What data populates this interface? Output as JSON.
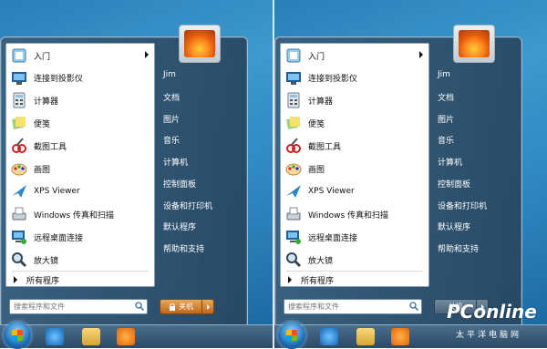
{
  "start_menu": {
    "items": [
      {
        "label": "入门",
        "icon": "getting-started-icon",
        "submenu": true
      },
      {
        "label": "连接到投影仪",
        "icon": "projector-icon"
      },
      {
        "label": "计算器",
        "icon": "calculator-icon"
      },
      {
        "label": "便笺",
        "icon": "sticky-notes-icon"
      },
      {
        "label": "截图工具",
        "icon": "snipping-tool-icon"
      },
      {
        "label": "画图",
        "icon": "paint-icon"
      },
      {
        "label": "XPS Viewer",
        "icon": "xps-viewer-icon"
      },
      {
        "label": "Windows 传真和扫描",
        "icon": "fax-scan-icon"
      },
      {
        "label": "远程桌面连接",
        "icon": "remote-desktop-icon"
      },
      {
        "label": "放大镜",
        "icon": "magnifier-icon"
      }
    ],
    "all_programs": "所有程序",
    "search_placeholder": "搜索程序和文件",
    "right_links": [
      "Jim",
      "文档",
      "图片",
      "音乐",
      "计算机",
      "控制面板",
      "设备和打印机",
      "默认程序",
      "帮助和支持"
    ],
    "shutdown_label": "关机",
    "shutdown_right_label": "关机"
  },
  "watermark": {
    "logo": "PConline",
    "subtitle": "太平洋电脑网"
  },
  "colors": {
    "accent_orange": "#c2661a",
    "desktop_blue": "#2d84bd"
  }
}
